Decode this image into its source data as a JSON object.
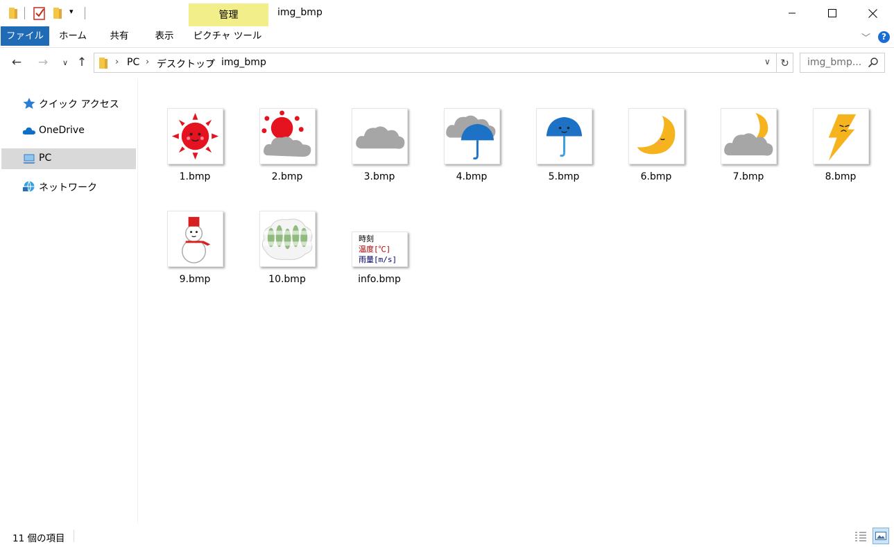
{
  "titlebar": {
    "manage_tab": "管理",
    "title": "img_bmp"
  },
  "ribbon": {
    "tabs": [
      "ファイル",
      "ホーム",
      "共有",
      "表示",
      "ピクチャ ツール"
    ],
    "help": "?"
  },
  "address": {
    "crumbs": [
      "PC",
      "デスクトップ",
      "img_bmp"
    ],
    "search_placeholder": "img_bmp..."
  },
  "sidebar": {
    "items": [
      {
        "label": "クイック アクセス",
        "icon": "star-icon"
      },
      {
        "label": "OneDrive",
        "icon": "cloud-icon"
      },
      {
        "label": "PC",
        "icon": "computer-icon",
        "selected": true
      },
      {
        "label": "ネットワーク",
        "icon": "network-icon"
      }
    ]
  },
  "files": [
    {
      "name": "1.bmp",
      "icon": "sun-icon"
    },
    {
      "name": "2.bmp",
      "icon": "sun-cloud-icon"
    },
    {
      "name": "3.bmp",
      "icon": "cloud-icon"
    },
    {
      "name": "4.bmp",
      "icon": "cloud-umbrella-icon"
    },
    {
      "name": "5.bmp",
      "icon": "umbrella-icon"
    },
    {
      "name": "6.bmp",
      "icon": "moon-icon"
    },
    {
      "name": "7.bmp",
      "icon": "moon-cloud-icon"
    },
    {
      "name": "8.bmp",
      "icon": "lightning-icon"
    },
    {
      "name": "9.bmp",
      "icon": "snowman-icon"
    },
    {
      "name": "10.bmp",
      "icon": "fog-icon"
    },
    {
      "name": "info.bmp",
      "icon": "info-text-icon",
      "lines": [
        "時刻",
        "温度[℃]",
        "雨量[m/s]"
      ],
      "line_colors": [
        "#000000",
        "#b00000",
        "#00006a"
      ]
    }
  ],
  "status": {
    "count": "11 個の項目"
  },
  "colors": {
    "file_tab": "#1f6bb5",
    "manage_tab": "#f2ee8a",
    "selection": "#d9d9d9",
    "sun_red": "#e4131f",
    "umbrella_blue": "#1e72c6",
    "moon_yellow": "#f5b41d",
    "cloud_gray": "#a0a0a0"
  }
}
